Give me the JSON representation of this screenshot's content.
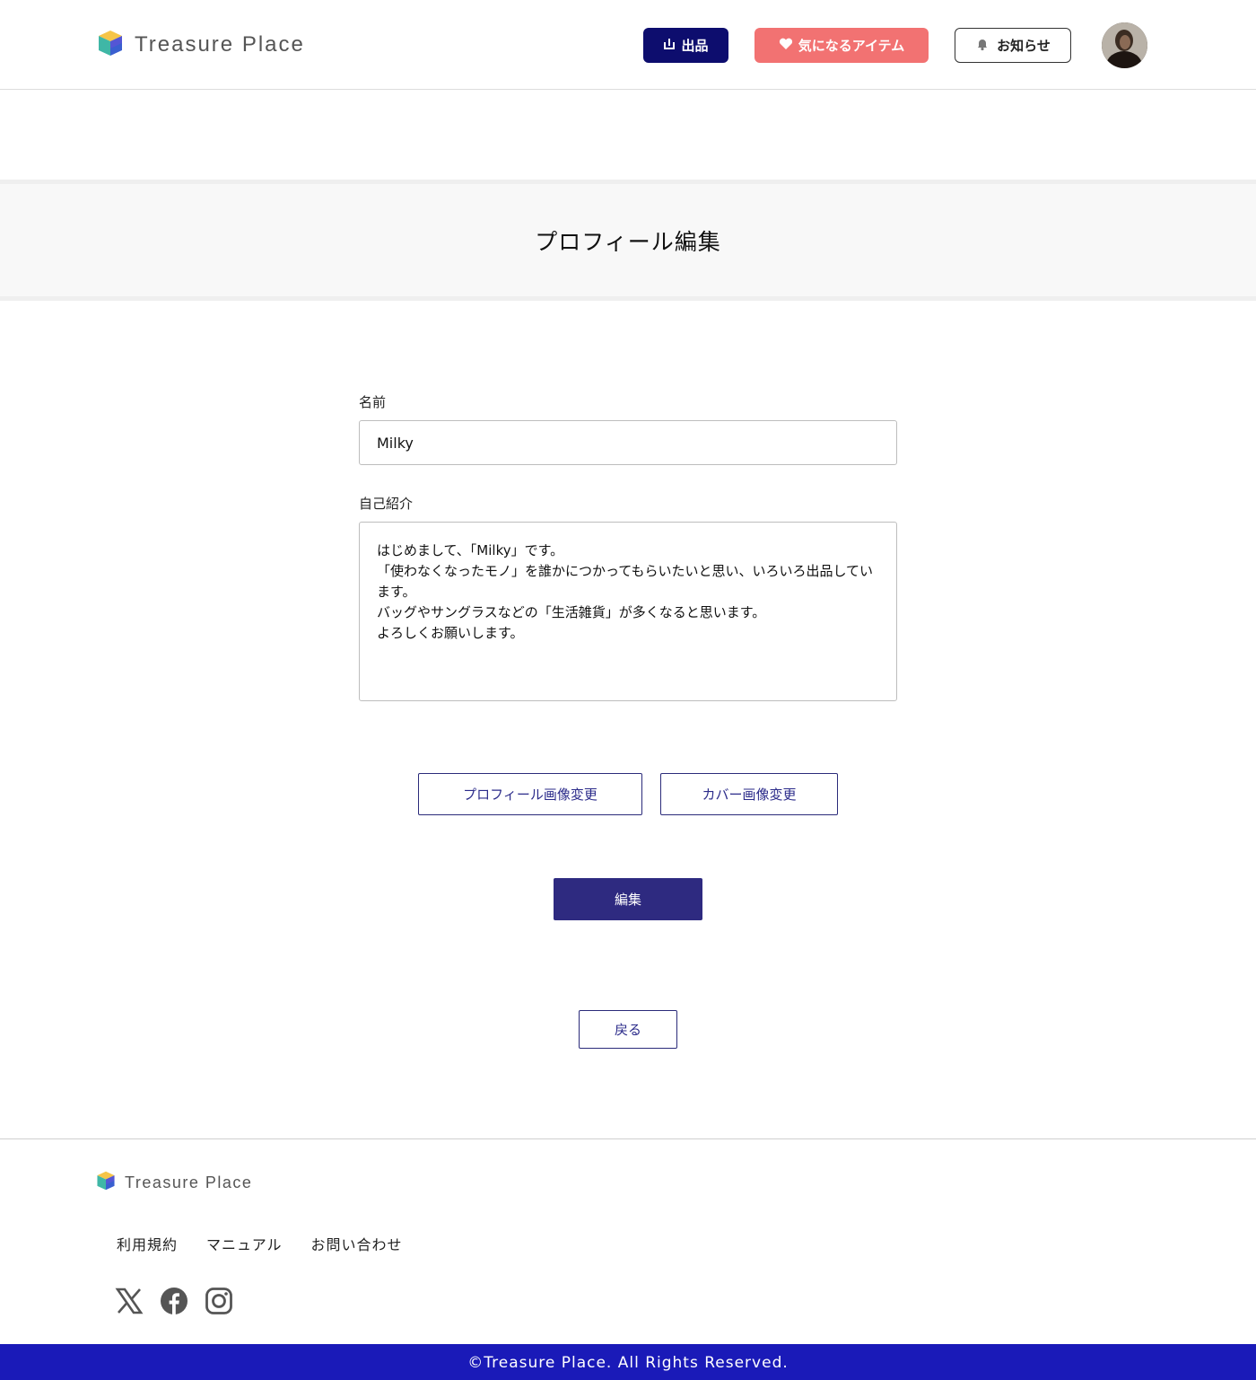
{
  "header": {
    "brand": "Treasure Place",
    "sell_label": "出品",
    "favorites_label": "気になるアイテム",
    "notifications_label": "お知らせ"
  },
  "page_title": "プロフィール編集",
  "form": {
    "name_label": "名前",
    "name_value": "Milky",
    "bio_label": "自己紹介",
    "bio_value": "はじめまして、「Milky」です。\n「使わなくなったモノ」を誰かにつかってもらいたいと思い、いろいろ出品しています。\nバッグやサングラスなどの「生活雑貨」が多くなると思います。\nよろしくお願いします。"
  },
  "actions": {
    "change_profile_image": "プロフィール画像変更",
    "change_cover_image": "カバー画像変更",
    "submit": "編集",
    "back": "戻る"
  },
  "footer": {
    "brand": "Treasure Place",
    "links": [
      "利用規約",
      "マニュアル",
      "お問い合わせ"
    ],
    "social": [
      "x-icon",
      "facebook-icon",
      "instagram-icon"
    ],
    "copyright": "©Treasure Place. All Rights Reserved."
  },
  "colors": {
    "primary_navy": "#0d0d6e",
    "favorite_pink": "#f27272",
    "edit_button": "#2e2a80",
    "copyright_bar": "#1a1ab8"
  }
}
